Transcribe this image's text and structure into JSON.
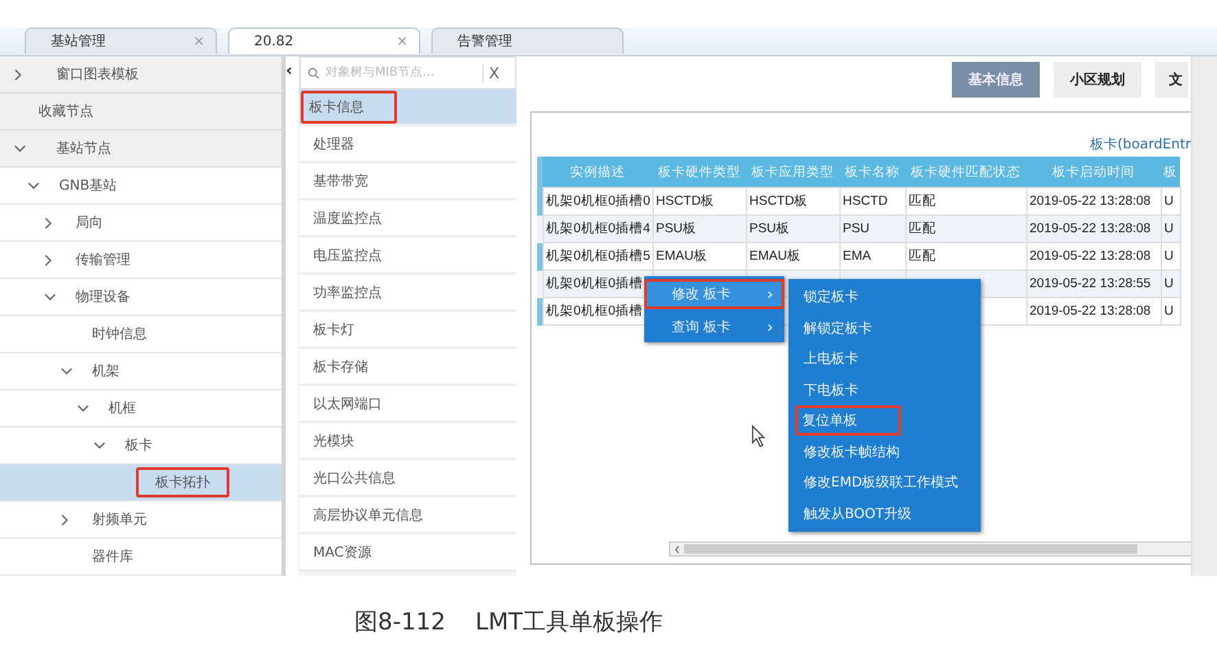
{
  "tabs": [
    {
      "label": "基站管理",
      "selected": false,
      "close": "×"
    },
    {
      "label": "20.82",
      "selected": true,
      "close": "×"
    },
    {
      "label": "告警管理",
      "selected": false
    }
  ],
  "tree": [
    {
      "label": "窗口图表模板",
      "expanded": false,
      "selected": false
    },
    {
      "label": "收藏节点",
      "selected": false
    },
    {
      "label": "基站节点",
      "expanded": true,
      "selected": false,
      "children": [
        {
          "label": "GNB基站",
          "expanded": true,
          "selected": false,
          "children": [
            {
              "label": "局向",
              "expanded": false,
              "selected": false
            },
            {
              "label": "传输管理",
              "expanded": false,
              "selected": false
            },
            {
              "label": "物理设备",
              "expanded": true,
              "selected": false,
              "children": [
                {
                  "label": "时钟信息",
                  "selected": false
                },
                {
                  "label": "机架",
                  "expanded": true,
                  "selected": false,
                  "children": [
                    {
                      "label": "机框",
                      "expanded": true,
                      "selected": false,
                      "children": [
                        {
                          "label": "板卡",
                          "expanded": true,
                          "selected": false,
                          "children": [
                            {
                              "label": "板卡拓扑",
                              "selected": true,
                              "highlighted": true
                            }
                          ]
                        }
                      ]
                    }
                  ]
                },
                {
                  "label": "射频单元",
                  "expanded": false,
                  "selected": false
                },
                {
                  "label": "器件库",
                  "selected": false
                }
              ]
            }
          ]
        }
      ]
    }
  ],
  "collapse_toggle": "‹",
  "search": {
    "placeholder": "对象树与MIB节点...",
    "clear": "X"
  },
  "mib_items": [
    {
      "label": "板卡信息",
      "selected": true,
      "highlighted": true
    },
    {
      "label": "处理器",
      "selected": false
    },
    {
      "label": "基带带宽",
      "selected": false
    },
    {
      "label": "温度监控点",
      "selected": false
    },
    {
      "label": "电压监控点",
      "selected": false
    },
    {
      "label": "功率监控点",
      "selected": false
    },
    {
      "label": "板卡灯",
      "selected": false
    },
    {
      "label": "板卡存储",
      "selected": false
    },
    {
      "label": "以太网端口",
      "selected": false
    },
    {
      "label": "光模块",
      "selected": false
    },
    {
      "label": "光口公共信息",
      "selected": false
    },
    {
      "label": "高层协议单元信息",
      "selected": false
    },
    {
      "label": "MAC资源",
      "selected": false
    }
  ],
  "view_tabs": [
    {
      "label": "基本信息",
      "selected": true
    },
    {
      "label": "小区规划",
      "selected": false
    },
    {
      "label": "文",
      "selected": false
    }
  ],
  "table": {
    "title": "板卡(boardEntr",
    "columns": [
      "实例描述",
      "板卡硬件类型",
      "板卡应用类型",
      "板卡名称",
      "板卡硬件匹配状态",
      "板卡启动时间",
      "板"
    ],
    "rows": [
      [
        "机架0机框0插槽0",
        "HSCTD板",
        "HSCTD板",
        "HSCTD",
        "匹配",
        "2019-05-22 13:28:08",
        "U"
      ],
      [
        "机架0机框0插槽4",
        "PSU板",
        "PSU板",
        "PSU",
        "匹配",
        "2019-05-22 13:28:08",
        "U"
      ],
      [
        "机架0机框0插槽5",
        "EMAU板",
        "EMAU板",
        "EMA",
        "匹配",
        "2019-05-22 13:28:08",
        "U"
      ],
      [
        "机架0机框0插槽",
        null,
        null,
        null,
        null,
        "2019-05-22 13:28:55",
        "U"
      ],
      [
        "机架0机框0插槽",
        null,
        null,
        null,
        null,
        "2019-05-22 13:28:08",
        "U"
      ]
    ]
  },
  "context_menu": [
    {
      "label": "修改 板卡",
      "arrow": "›",
      "selected": true,
      "highlighted": true
    },
    {
      "label": "查询 板卡",
      "arrow": "›",
      "selected": false,
      "highlighted": false
    }
  ],
  "submenu": [
    {
      "label": "锁定板卡",
      "highlighted": false
    },
    {
      "label": "解锁定板卡",
      "highlighted": false
    },
    {
      "label": "上电板卡",
      "highlighted": false
    },
    {
      "label": "下电板卡",
      "highlighted": false
    },
    {
      "label": "复位单板",
      "highlighted": true
    },
    {
      "label": "修改板卡帧结构",
      "highlighted": false
    },
    {
      "label": "修改EMD板级联工作模式",
      "highlighted": false
    },
    {
      "label": "触发从BOOT升级",
      "highlighted": false
    }
  ],
  "caption": "图8-112    LMT工具单板操作"
}
